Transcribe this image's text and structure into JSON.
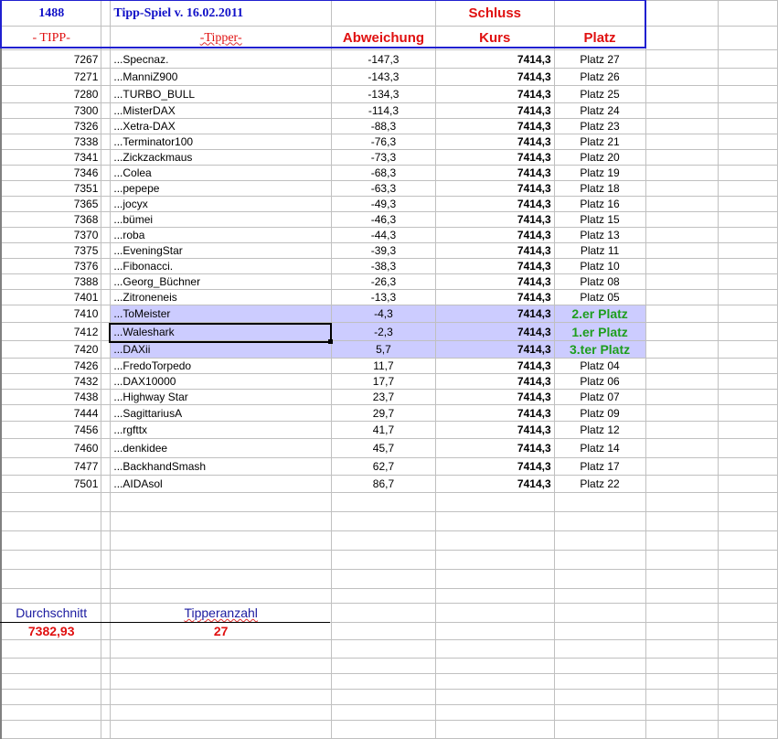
{
  "header": {
    "count": "1488",
    "title": "Tipp-Spiel v. 16.02.2011",
    "schluss": "Schluss",
    "col_tipp": "- TIPP-",
    "col_tipper": "-Tipper-",
    "col_abweichung": "Abweichung",
    "col_kurs": "Kurs",
    "col_platz": "Platz"
  },
  "colors": {
    "highlight": "#ccccff",
    "winner_text": "#1e9e1e",
    "header_red": "#e01010",
    "header_blue": "#1010c8"
  },
  "rows": [
    {
      "tipp": "7267",
      "tipper": "...Specnaz.",
      "abw": "-147,3",
      "kurs": "7414,3",
      "platz": "Platz 27"
    },
    {
      "tipp": "7271",
      "tipper": "...ManniZ900",
      "abw": "-143,3",
      "kurs": "7414,3",
      "platz": "Platz 26"
    },
    {
      "tipp": "7280",
      "tipper": "...TURBO_BULL",
      "abw": "-134,3",
      "kurs": "7414,3",
      "platz": "Platz 25"
    },
    {
      "tipp": "7300",
      "tipper": "...MisterDAX",
      "abw": "-114,3",
      "kurs": "7414,3",
      "platz": "Platz 24"
    },
    {
      "tipp": "7326",
      "tipper": "...Xetra-DAX",
      "abw": "-88,3",
      "kurs": "7414,3",
      "platz": "Platz 23"
    },
    {
      "tipp": "7338",
      "tipper": "...Terminator100",
      "abw": "-76,3",
      "kurs": "7414,3",
      "platz": "Platz 21"
    },
    {
      "tipp": "7341",
      "tipper": "...Zickzackmaus",
      "abw": "-73,3",
      "kurs": "7414,3",
      "platz": "Platz 20"
    },
    {
      "tipp": "7346",
      "tipper": "...Colea",
      "abw": "-68,3",
      "kurs": "7414,3",
      "platz": "Platz 19"
    },
    {
      "tipp": "7351",
      "tipper": "...pepepe",
      "abw": "-63,3",
      "kurs": "7414,3",
      "platz": "Platz 18"
    },
    {
      "tipp": "7365",
      "tipper": "...jocyx",
      "abw": "-49,3",
      "kurs": "7414,3",
      "platz": "Platz 16"
    },
    {
      "tipp": "7368",
      "tipper": "...bümei",
      "abw": "-46,3",
      "kurs": "7414,3",
      "platz": "Platz 15"
    },
    {
      "tipp": "7370",
      "tipper": "...roba",
      "abw": "-44,3",
      "kurs": "7414,3",
      "platz": "Platz 13"
    },
    {
      "tipp": "7375",
      "tipper": "...EveningStar",
      "abw": "-39,3",
      "kurs": "7414,3",
      "platz": "Platz 11"
    },
    {
      "tipp": "7376",
      "tipper": "...Fibonacci.",
      "abw": "-38,3",
      "kurs": "7414,3",
      "platz": "Platz 10"
    },
    {
      "tipp": "7388",
      "tipper": "...Georg_Büchner",
      "abw": "-26,3",
      "kurs": "7414,3",
      "platz": "Platz 08"
    },
    {
      "tipp": "7401",
      "tipper": "...Zitroneneis",
      "abw": "-13,3",
      "kurs": "7414,3",
      "platz": "Platz 05"
    },
    {
      "tipp": "7410",
      "tipper": "...ToMeister",
      "abw": "-4,3",
      "kurs": "7414,3",
      "platz": "2.er Platz",
      "top": true
    },
    {
      "tipp": "7412",
      "tipper": "...Waleshark",
      "abw": "-2,3",
      "kurs": "7414,3",
      "platz": "1.er Platz",
      "top": true
    },
    {
      "tipp": "7420",
      "tipper": "...DAXii",
      "abw": "5,7",
      "kurs": "7414,3",
      "platz": "3.ter Platz",
      "top": true
    },
    {
      "tipp": "7426",
      "tipper": "...FredoTorpedo",
      "abw": "11,7",
      "kurs": "7414,3",
      "platz": "Platz 04"
    },
    {
      "tipp": "7432",
      "tipper": "...DAX10000",
      "abw": "17,7",
      "kurs": "7414,3",
      "platz": "Platz 06"
    },
    {
      "tipp": "7438",
      "tipper": "...Highway Star",
      "abw": "23,7",
      "kurs": "7414,3",
      "platz": "Platz 07"
    },
    {
      "tipp": "7444",
      "tipper": "...SagittariusA",
      "abw": "29,7",
      "kurs": "7414,3",
      "platz": "Platz 09"
    },
    {
      "tipp": "7456",
      "tipper": "...rgfttx",
      "abw": "41,7",
      "kurs": "7414,3",
      "platz": "Platz 12"
    },
    {
      "tipp": "7460",
      "tipper": "...denkidee",
      "abw": "45,7",
      "kurs": "7414,3",
      "platz": "Platz 14"
    },
    {
      "tipp": "7477",
      "tipper": "...BackhandSmash",
      "abw": "62,7",
      "kurs": "7414,3",
      "platz": "Platz 17"
    },
    {
      "tipp": "7501",
      "tipper": "...AIDAsol",
      "abw": "86,7",
      "kurs": "7414,3",
      "platz": "Platz 22"
    }
  ],
  "summary": {
    "avg_label": "Durchschnitt",
    "avg_value": "7382,93",
    "count_label": "Tipperanzahl",
    "count_value": "27"
  }
}
